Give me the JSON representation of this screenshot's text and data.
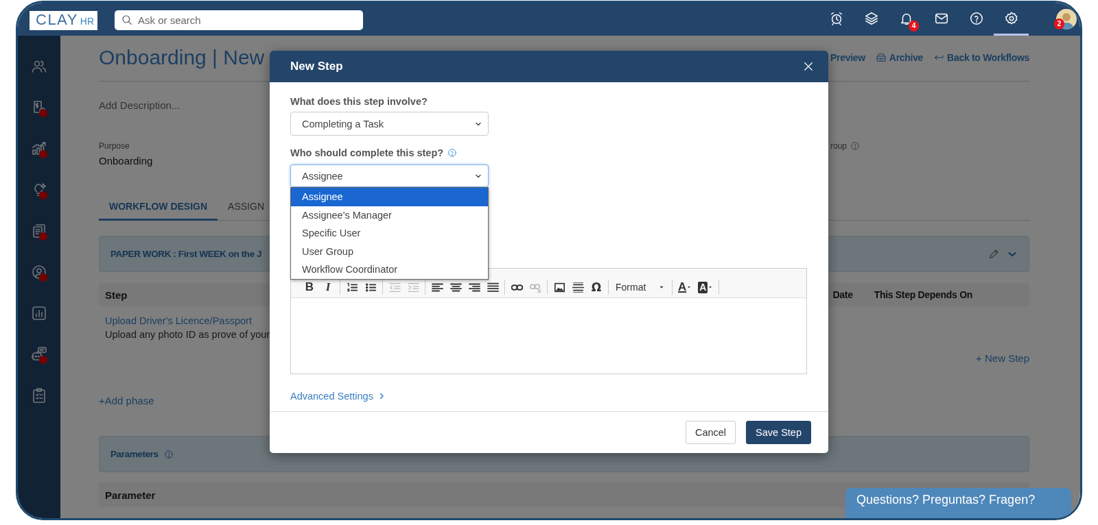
{
  "topbar": {
    "logo": {
      "text": "CLAY",
      "suffix": "HR"
    },
    "search": {
      "placeholder": "Ask or search"
    },
    "icons": [
      {
        "kind": "alarm",
        "selected": false
      },
      {
        "kind": "layers",
        "selected": false
      },
      {
        "kind": "bell",
        "selected": false,
        "badge": "4"
      },
      {
        "kind": "mail",
        "selected": false
      },
      {
        "kind": "help",
        "selected": false
      },
      {
        "kind": "gear",
        "selected": true
      }
    ],
    "avatar": {
      "badge": "2"
    }
  },
  "sidebar": {
    "items": [
      {
        "kind": "people",
        "dot": false
      },
      {
        "kind": "money",
        "dot": true
      },
      {
        "kind": "growth",
        "dot": true
      },
      {
        "kind": "bulb",
        "dot": true
      },
      {
        "kind": "docs",
        "dot": true
      },
      {
        "kind": "person",
        "dot": true
      },
      {
        "kind": "bars",
        "dot": false
      },
      {
        "kind": "bot",
        "dot": true
      },
      {
        "kind": "clipboard",
        "dot": false
      }
    ]
  },
  "page": {
    "title": "Onboarding | New",
    "actions": [
      {
        "kind": "preview",
        "label": "Preview"
      },
      {
        "kind": "archive",
        "label": "Archive"
      },
      {
        "kind": "back",
        "label": "Back to Workflows"
      }
    ],
    "description": {
      "placeholder": "Add Description..."
    },
    "fields": [
      {
        "label": "Purpose",
        "value": "Onboarding"
      },
      {
        "label": "roup",
        "help": true
      }
    ],
    "tabs": [
      {
        "label": "WORKFLOW DESIGN",
        "selected": true
      },
      {
        "label": "ASSIGN",
        "selected": false
      }
    ],
    "phase": {
      "title": "PAPER WORK : First WEEK on the J"
    },
    "steps_table": {
      "columns": [
        "Step",
        "Date",
        "This Step Depends On"
      ],
      "rows": [
        {
          "title": "Upload Driver's Licence/Passport",
          "description": "Upload any photo ID as prove of your"
        }
      ]
    },
    "new_step": "+ New Step",
    "add_phase": "+Add phase",
    "parameters": {
      "title": "Parameters",
      "columns": [
        "Parameter"
      ]
    }
  },
  "modal": {
    "title": "New Step",
    "involve": {
      "label": "What does this step involve?",
      "value": "Completing a Task"
    },
    "who": {
      "label": "Who should complete this step?",
      "value": "Assignee",
      "expanded": true,
      "options": [
        {
          "label": "Assignee",
          "selected": true
        },
        {
          "label": "Assignee's Manager",
          "selected": false
        },
        {
          "label": "Specific User",
          "selected": false
        },
        {
          "label": "User Group",
          "selected": false
        },
        {
          "label": "Workflow Coordinator",
          "selected": false
        }
      ]
    },
    "toolbar": [
      [
        {
          "kind": "bold",
          "text": "B",
          "disabled": false
        },
        {
          "kind": "italic",
          "text": "I",
          "disabled": false
        }
      ],
      [
        {
          "kind": "ol",
          "disabled": false
        },
        {
          "kind": "ul",
          "disabled": false
        }
      ],
      [
        {
          "kind": "outdent",
          "disabled": true
        },
        {
          "kind": "indent",
          "disabled": true
        }
      ],
      [
        {
          "kind": "align-left",
          "disabled": false
        },
        {
          "kind": "align-center",
          "disabled": false
        },
        {
          "kind": "align-right",
          "disabled": false
        },
        {
          "kind": "justify",
          "disabled": false
        }
      ],
      [
        {
          "kind": "link",
          "disabled": false
        },
        {
          "kind": "unlink",
          "disabled": true
        }
      ],
      [
        {
          "kind": "image",
          "disabled": false
        },
        {
          "kind": "hr",
          "disabled": false
        },
        {
          "kind": "special",
          "text": "Ω",
          "disabled": false
        }
      ],
      [
        {
          "kind": "format",
          "text": "Format",
          "disabled": false
        }
      ],
      [
        {
          "kind": "text-color",
          "text": "A",
          "disabled": false
        },
        {
          "kind": "bg-color",
          "text": "A",
          "disabled": false
        }
      ]
    ],
    "advanced": "Advanced Settings",
    "buttons": [
      {
        "kind": "secondary",
        "label": "Cancel"
      },
      {
        "kind": "primary",
        "label": "Save Step"
      }
    ]
  },
  "chat": {
    "label": "Questions? Preguntas? Fragen?"
  }
}
